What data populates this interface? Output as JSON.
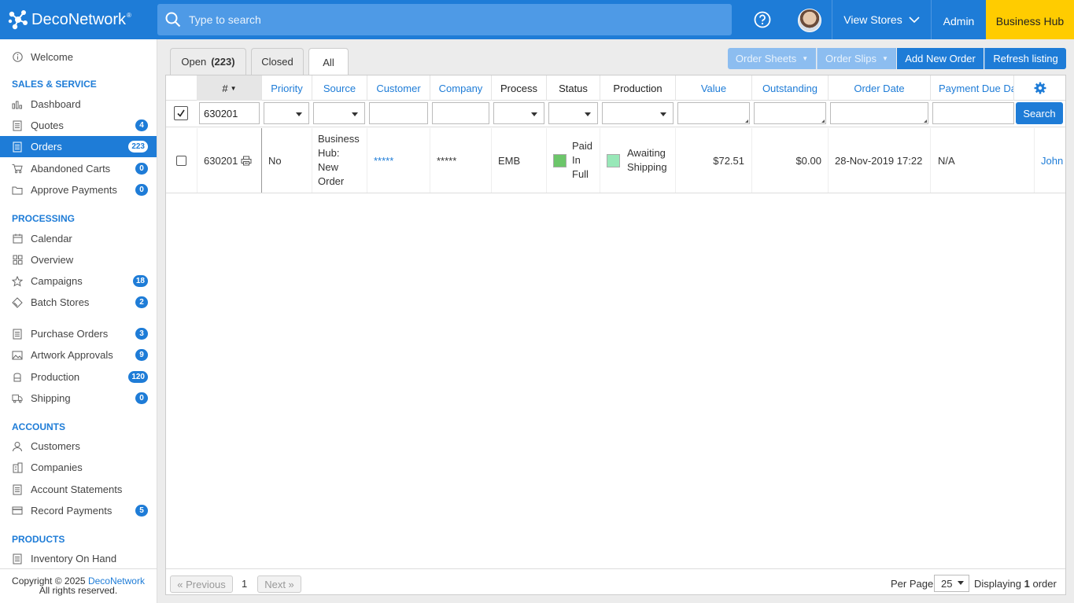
{
  "header": {
    "logo_text": "DecoNetwork",
    "logo_tm": "®",
    "search_placeholder": "Type to search",
    "view_stores": "View Stores",
    "admin": "Admin",
    "business_hub": "Business Hub"
  },
  "sidebar": {
    "welcome": "Welcome",
    "sections": {
      "sales": "SALES & SERVICE",
      "processing": "PROCESSING",
      "accounts": "ACCOUNTS",
      "products": "PRODUCTS"
    },
    "items": [
      {
        "label": "Dashboard",
        "badge": ""
      },
      {
        "label": "Quotes",
        "badge": "4"
      },
      {
        "label": "Orders",
        "badge": "223"
      },
      {
        "label": "Abandoned Carts",
        "badge": "0"
      },
      {
        "label": "Approve Payments",
        "badge": "0"
      },
      {
        "label": "Calendar",
        "badge": ""
      },
      {
        "label": "Overview",
        "badge": ""
      },
      {
        "label": "Campaigns",
        "badge": "18"
      },
      {
        "label": "Batch Stores",
        "badge": "2"
      },
      {
        "label": "Purchase Orders",
        "badge": "3"
      },
      {
        "label": "Artwork Approvals",
        "badge": "9"
      },
      {
        "label": "Production",
        "badge": "120"
      },
      {
        "label": "Shipping",
        "badge": "0"
      },
      {
        "label": "Customers",
        "badge": ""
      },
      {
        "label": "Companies",
        "badge": ""
      },
      {
        "label": "Account Statements",
        "badge": ""
      },
      {
        "label": "Record Payments",
        "badge": "5"
      },
      {
        "label": "Inventory On Hand",
        "badge": ""
      }
    ],
    "copyright_prefix": "Copyright © 2025",
    "copyright_link": "DecoNetwork",
    "copyright_rights": "All rights reserved."
  },
  "tabs": {
    "open": "Open",
    "open_count": "(223)",
    "closed": "Closed",
    "all": "All"
  },
  "toolbar": {
    "order_sheets": "Order Sheets",
    "order_slips": "Order Slips",
    "add_new_order": "Add New Order",
    "refresh_listing": "Refresh listing"
  },
  "table": {
    "headers": {
      "num": "#",
      "priority": "Priority",
      "source": "Source",
      "customer": "Customer",
      "company": "Company",
      "process": "Process",
      "status": "Status",
      "production": "Production",
      "value": "Value",
      "outstanding": "Outstanding",
      "order_date": "Order Date",
      "payment_due": "Payment Due Da"
    },
    "filter_order_number": "630201",
    "search_button": "Search",
    "row": {
      "order_number": "630201",
      "priority": "No",
      "source_lines": [
        "Business",
        "Hub:",
        "New",
        "Order"
      ],
      "customer": "*****",
      "company": "*****",
      "process": "EMB",
      "status_lines": [
        "Paid",
        "In",
        "Full"
      ],
      "status_color": "#6cc66a",
      "production_lines": [
        "Awaiting",
        "Shipping"
      ],
      "production_color": "#98e8b8",
      "value": "$72.51",
      "outstanding": "$0.00",
      "order_date": "28-Nov-2019 17:22",
      "payment_due": "N/A",
      "assignee": "John"
    }
  },
  "pager": {
    "previous": "« Previous",
    "page": "1",
    "next": "Next »",
    "per_page_label": "Per Page",
    "per_page_value": "25",
    "displaying_prefix": "Displaying",
    "displaying_count": "1",
    "displaying_suffix": "order"
  },
  "colors": {
    "primary": "#1e7cd7",
    "business_hub": "#ffcc00"
  }
}
